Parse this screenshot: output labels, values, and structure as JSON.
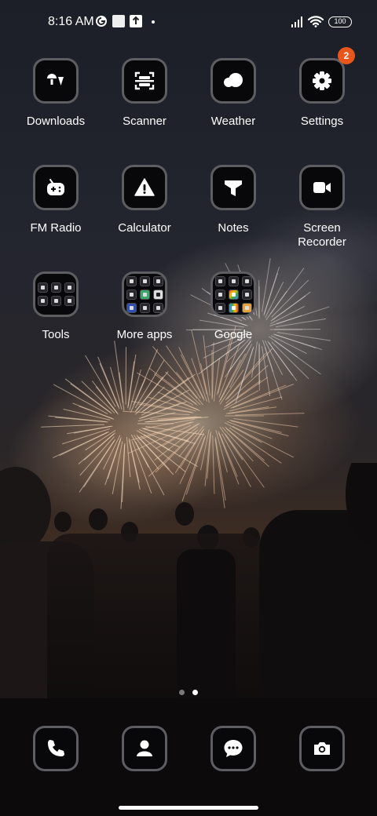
{
  "status_bar": {
    "time": "8:16 AM",
    "battery": "100",
    "left_icons": [
      "g-circle-icon",
      "white-square-icon",
      "upload-box-icon",
      "dot-icon"
    ],
    "right_icons": [
      "signal-icon",
      "wifi-icon",
      "battery-icon"
    ]
  },
  "home": {
    "apps": [
      {
        "label": "Downloads",
        "icon": "downloads-icon"
      },
      {
        "label": "Scanner",
        "icon": "scanner-icon"
      },
      {
        "label": "Weather",
        "icon": "weather-icon"
      },
      {
        "label": "Settings",
        "icon": "gear-icon",
        "badge": "2"
      },
      {
        "label": "FM Radio",
        "icon": "radio-icon"
      },
      {
        "label": "Calculator",
        "icon": "warning-triangle-icon"
      },
      {
        "label": "Notes",
        "icon": "funnel-icon"
      },
      {
        "label": "Screen\nRecorder",
        "icon": "video-camera-icon"
      }
    ],
    "folders": [
      {
        "label": "Tools"
      },
      {
        "label": "More apps"
      },
      {
        "label": "Google"
      }
    ]
  },
  "page_indicator": {
    "total": 2,
    "current": 2
  },
  "dock": [
    {
      "name": "phone",
      "icon": "phone-icon"
    },
    {
      "name": "contacts",
      "icon": "person-icon"
    },
    {
      "name": "messages",
      "icon": "chat-bubble-icon"
    },
    {
      "name": "camera",
      "icon": "camera-icon"
    }
  ],
  "colors": {
    "badge": "#e9561c",
    "icon_border": "#5d5d62",
    "icon_bg": "#08080a"
  }
}
